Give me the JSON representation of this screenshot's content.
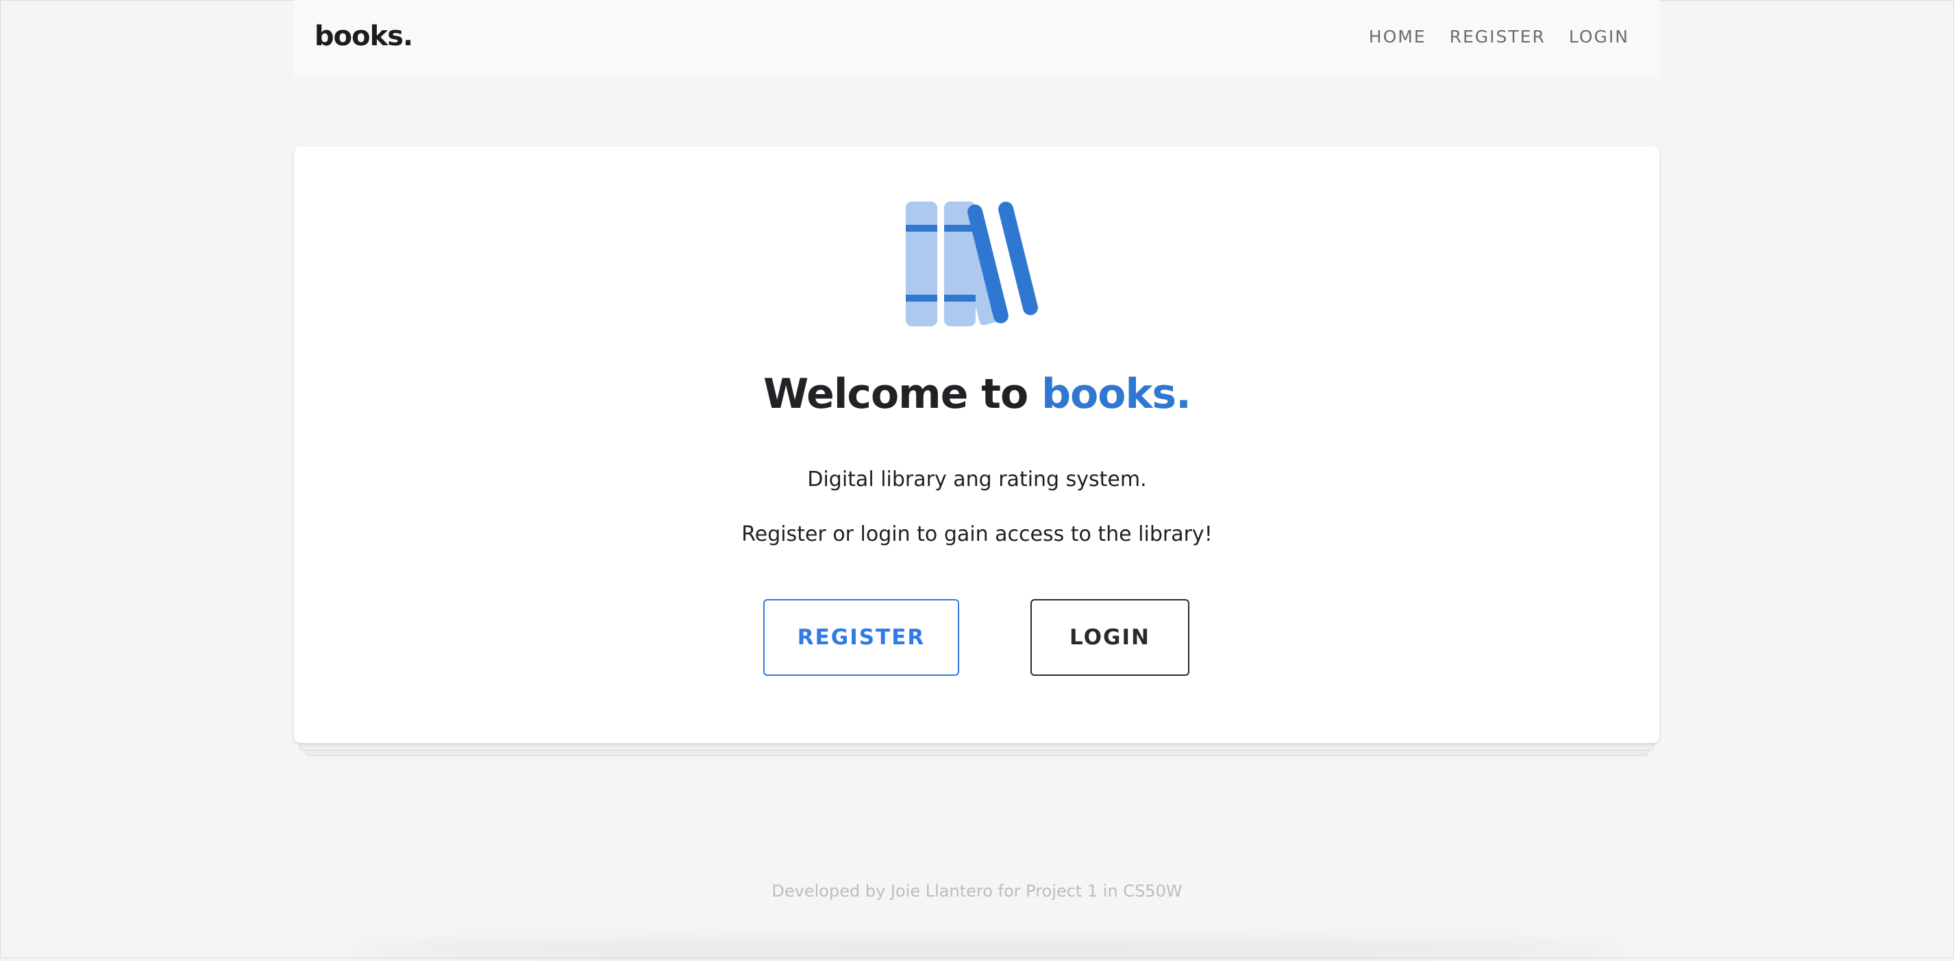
{
  "navbar": {
    "brand": "books.",
    "links": [
      {
        "label": "HOME"
      },
      {
        "label": "REGISTER"
      },
      {
        "label": "LOGIN"
      }
    ]
  },
  "hero": {
    "headline_prefix": "Welcome to ",
    "headline_accent": "books.",
    "subtitle": "Digital library ang rating system.",
    "cta_text": "Register or login to gain access to the library!",
    "buttons": {
      "register_label": "REGISTER",
      "login_label": "LOGIN"
    },
    "illustration_icon": "books-icon"
  },
  "footer": {
    "text": "Developed by Joie Llantero for Project 1 in CS50W"
  },
  "colors": {
    "accent": "#2f77d1",
    "book_light": "#adc9ef",
    "book_dark": "#2f77d1",
    "page_background": "#f5f5f6",
    "navbar_background": "#f8f9fa"
  }
}
